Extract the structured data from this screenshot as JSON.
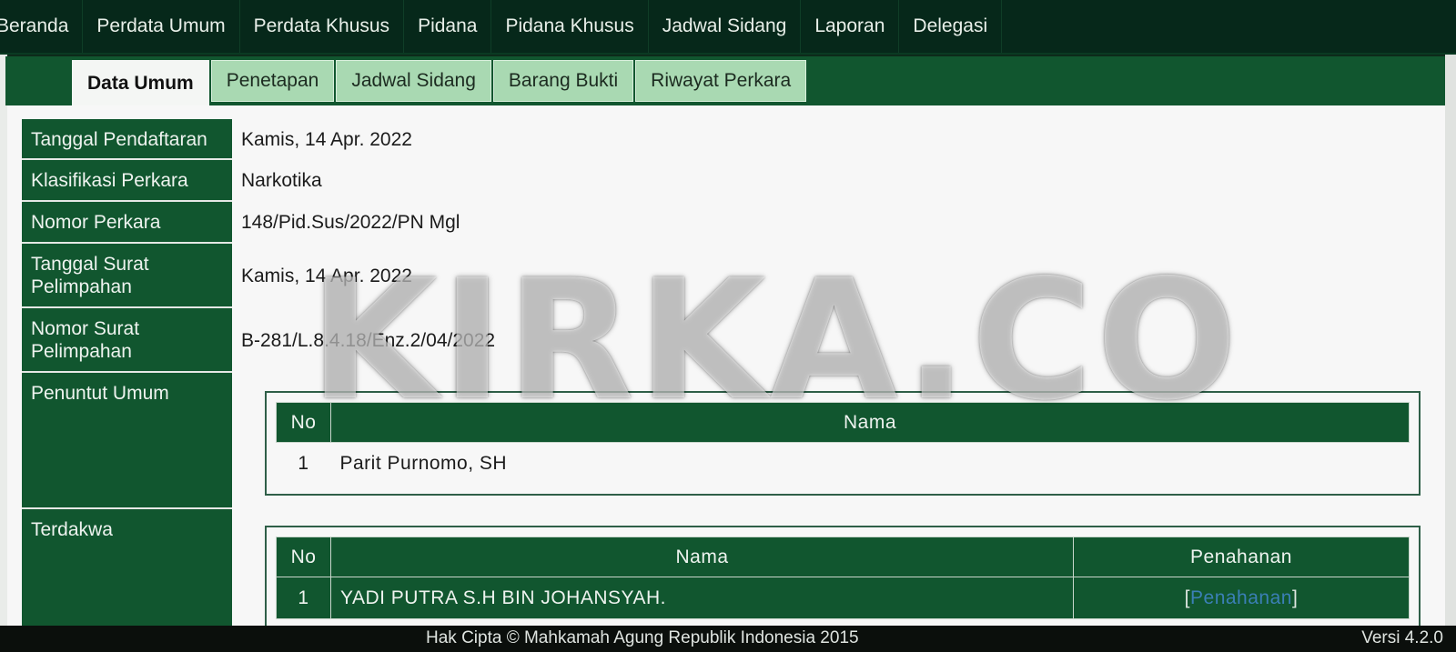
{
  "nav": {
    "items": [
      "Beranda",
      "Perdata Umum",
      "Perdata Khusus",
      "Pidana",
      "Pidana Khusus",
      "Jadwal Sidang",
      "Laporan",
      "Delegasi"
    ]
  },
  "tabs": [
    "Data Umum",
    "Penetapan",
    "Jadwal Sidang",
    "Barang Bukti",
    "Riwayat Perkara"
  ],
  "active_tab": "Data Umum",
  "fields": {
    "tanggal_pendaftaran": {
      "label": "Tanggal Pendaftaran",
      "value": "Kamis, 14 Apr. 2022"
    },
    "klasifikasi_perkara": {
      "label": "Klasifikasi Perkara",
      "value": "Narkotika"
    },
    "nomor_perkara": {
      "label": "Nomor Perkara",
      "value": "148/Pid.Sus/2022/PN Mgl"
    },
    "tanggal_surat_pelimpahan": {
      "label": "Tanggal Surat Pelimpahan",
      "value": "Kamis, 14 Apr. 2022"
    },
    "nomor_surat_pelimpahan": {
      "label": "Nomor Surat Pelimpahan",
      "value": "B-281/L.8.4.18/Enz.2/04/2022"
    },
    "penuntut_umum": {
      "label": "Penuntut Umum"
    },
    "terdakwa": {
      "label": "Terdakwa"
    }
  },
  "penuntut_table": {
    "headers": {
      "no": "No",
      "nama": "Nama"
    },
    "rows": [
      {
        "no": "1",
        "nama": "Parit Purnomo, SH"
      }
    ]
  },
  "terdakwa_table": {
    "headers": {
      "no": "No",
      "nama": "Nama",
      "penahanan": "Penahanan"
    },
    "rows": [
      {
        "no": "1",
        "nama": "YADI PUTRA S.H BIN JOHANSYAH.",
        "penahanan_link": "Penahanan",
        "bracket_open": "[",
        "bracket_close": "]"
      }
    ]
  },
  "watermark": "KIRKA.CO",
  "footer": {
    "copyright": "Hak Cipta © Mahkamah Agung Republik Indonesia 2015",
    "version": "Versi 4.2.0"
  },
  "colors": {
    "primary_green": "#11562f",
    "nav_dark": "#06281a",
    "tab_inactive": "#a9d9b2",
    "link": "#3b7fb6"
  }
}
